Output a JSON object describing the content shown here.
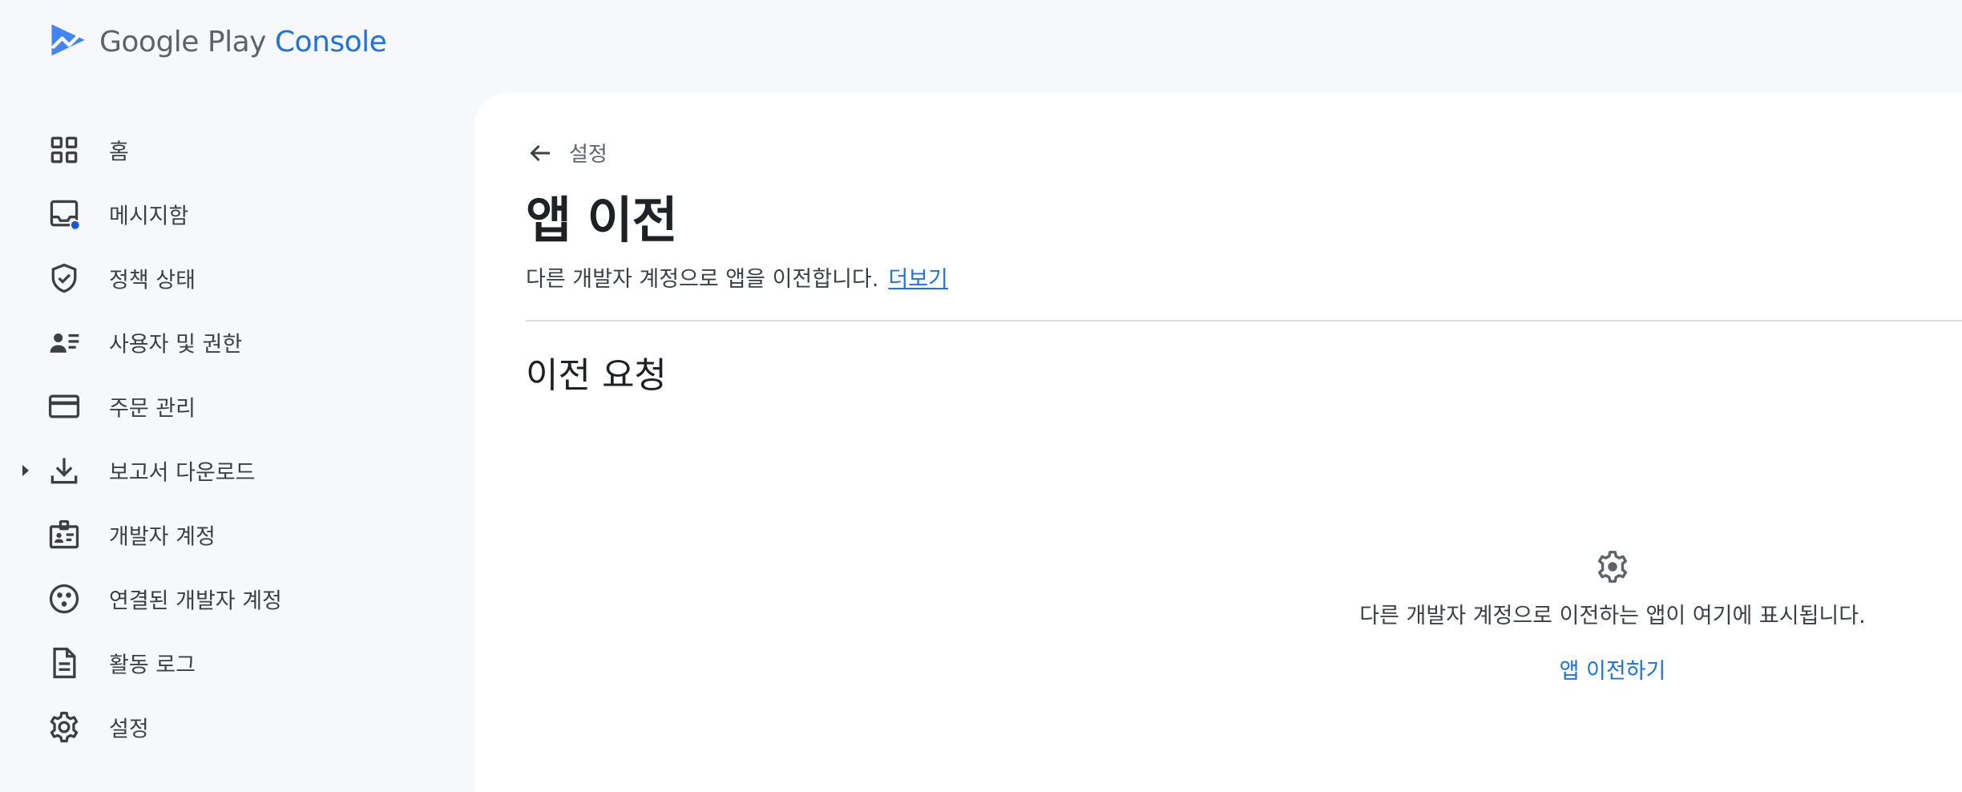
{
  "brand": {
    "google_play": "Google Play",
    "console": "Console",
    "colors": {
      "primary": "#1a73e8",
      "icon_blue": "#4285f4",
      "badge": "#1a56d6"
    }
  },
  "sidebar": {
    "items": [
      {
        "label": "홈",
        "icon": "dashboard-icon"
      },
      {
        "label": "메시지함",
        "icon": "inbox-icon"
      },
      {
        "label": "정책 상태",
        "icon": "shield-check-icon"
      },
      {
        "label": "사용자 및 권한",
        "icon": "manage-accounts-icon"
      },
      {
        "label": "주문 관리",
        "icon": "credit-card-icon"
      },
      {
        "label": "보고서 다운로드",
        "icon": "download-icon"
      },
      {
        "label": "개발자 계정",
        "icon": "badge-icon"
      },
      {
        "label": "연결된 개발자 계정",
        "icon": "linked-accounts-icon"
      },
      {
        "label": "활동 로그",
        "icon": "document-icon"
      },
      {
        "label": "설정",
        "icon": "gear-icon"
      }
    ]
  },
  "main": {
    "back_label": "설정",
    "title": "앱 이전",
    "description": "다른 개발자 계정으로 앱을 이전합니다.",
    "learn_more": "더보기",
    "section_title": "이전 요청",
    "empty_state": {
      "icon": "gear-icon",
      "text": "다른 개발자 계정으로 이전하는 앱이 여기에 표시됩니다.",
      "action": "앱 이전하기"
    }
  }
}
